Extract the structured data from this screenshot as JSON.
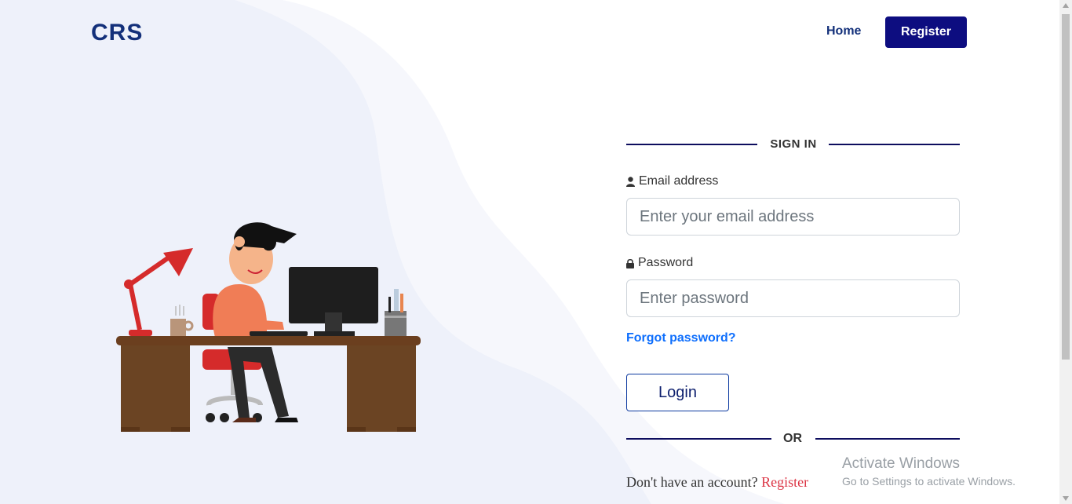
{
  "brand": "CRS",
  "nav": {
    "home_label": "Home",
    "register_label": "Register"
  },
  "colors": {
    "brand_blue": "#13307a",
    "primary_navy": "#0d0d80",
    "link_blue": "#0d6efd",
    "register_red": "#dc3545",
    "bg_wave": "#eef1fa"
  },
  "signin": {
    "title": "SIGN IN",
    "email_label": "Email address",
    "email_placeholder": "Enter your email address",
    "password_label": "Password",
    "password_placeholder": "Enter password",
    "forgot_label": "Forgot password?",
    "login_label": "Login",
    "or_label": "OR",
    "no_account_text": "Don't have an account?",
    "register_link": "Register"
  },
  "watermark": {
    "line1": "Activate Windows",
    "line2": "Go to Settings to activate Windows."
  },
  "icons": {
    "email": "user-icon",
    "password": "lock-icon"
  }
}
